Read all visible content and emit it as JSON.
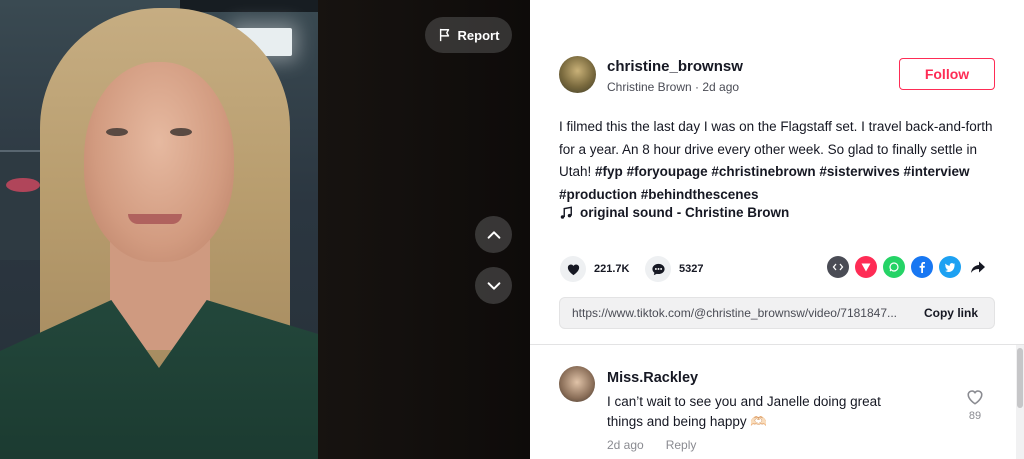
{
  "video": {
    "report_label": "Report"
  },
  "author": {
    "username": "christine_brownsw",
    "nickname": "Christine Brown",
    "posted": "2d ago",
    "separator": " · ",
    "follow_label": "Follow"
  },
  "caption": {
    "text": "I filmed this the last day I was on the Flagstaff set. I travel back-and-forth for a year. An 8 hour drive every other week. So glad to finally settle in Utah! ",
    "hashtags": [
      "#fyp",
      "#foryoupage",
      "#christinebrown",
      "#sisterwives",
      "#interview",
      "#production",
      "#behindthescenes"
    ]
  },
  "sound": {
    "label": "original sound - Christine Brown"
  },
  "stats": {
    "likes": "221.7K",
    "comments": "5327"
  },
  "share": {
    "icons": [
      {
        "name": "embed-icon",
        "color": "#4a4c55"
      },
      {
        "name": "send-icon",
        "color": "#fe2c55"
      },
      {
        "name": "whatsapp-icon",
        "color": "#25d366"
      },
      {
        "name": "facebook-icon",
        "color": "#1877f2"
      },
      {
        "name": "twitter-icon",
        "color": "#1da1f2"
      },
      {
        "name": "share-arrow-icon",
        "color": "#161823"
      }
    ]
  },
  "link": {
    "url": "https://www.tiktok.com/@christine_brownsw/video/7181847...",
    "copy_label": "Copy link"
  },
  "comments": [
    {
      "user": "Miss.Rackley",
      "text": "I can’t wait to see you and Janelle doing great things and being happy 🫶🏻",
      "time": "2d ago",
      "reply_label": "Reply",
      "likes": "89"
    }
  ],
  "colors": {
    "accent": "#fe2c55",
    "text": "#161823",
    "muted": "#8a8b91"
  }
}
